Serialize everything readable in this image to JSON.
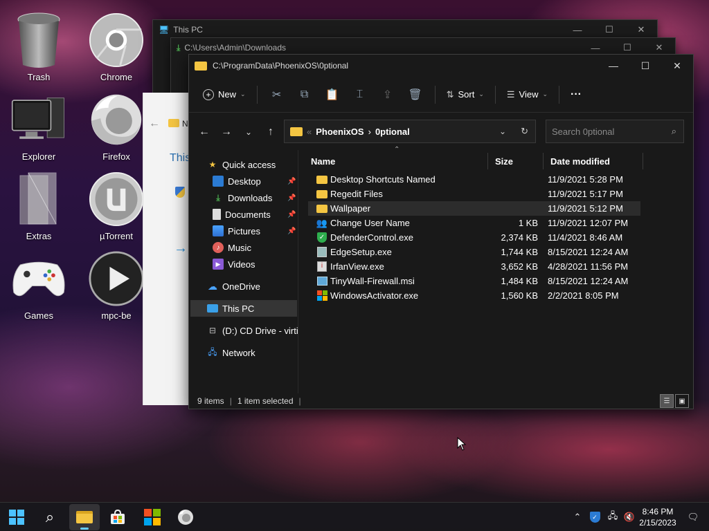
{
  "desktop": {
    "icons": [
      {
        "label": "Trash",
        "icon": "trash-icon"
      },
      {
        "label": "Chrome",
        "icon": "chrome-icon"
      },
      {
        "label": "Explorer",
        "icon": "explorer-icon"
      },
      {
        "label": "Firefox",
        "icon": "firefox-icon"
      },
      {
        "label": "Extras",
        "icon": "extras-icon"
      },
      {
        "label": "µTorrent",
        "icon": "utorrent-icon"
      },
      {
        "label": "Games",
        "icon": "games-icon"
      },
      {
        "label": "mpc-be",
        "icon": "mpc-be-icon"
      }
    ]
  },
  "back_windows": {
    "this_pc": {
      "title": "This PC"
    },
    "downloads": {
      "title": "C:\\Users\\Admin\\Downloads"
    },
    "partial": {
      "letter": "N",
      "text": "This"
    }
  },
  "main_window": {
    "title": "C:\\ProgramData\\PhoenixOS\\0ptional",
    "toolbar": {
      "new_label": "New",
      "sort_label": "Sort",
      "view_label": "View",
      "more_label": "···"
    },
    "address": {
      "prefix": "«",
      "crumbs": [
        "PhoenixOS",
        "0ptional"
      ],
      "separator": "›"
    },
    "search": {
      "placeholder": "Search 0ptional"
    },
    "nav": [
      {
        "label": "Quick access",
        "icon": "star-icon"
      },
      {
        "label": "Desktop",
        "icon": "desktop-icon",
        "pinned": true
      },
      {
        "label": "Downloads",
        "icon": "download-icon",
        "pinned": true
      },
      {
        "label": "Documents",
        "icon": "document-icon",
        "pinned": true
      },
      {
        "label": "Pictures",
        "icon": "pictures-icon",
        "pinned": true
      },
      {
        "label": "Music",
        "icon": "music-icon"
      },
      {
        "label": "Videos",
        "icon": "videos-icon"
      },
      {
        "label": "OneDrive",
        "icon": "cloud-icon"
      },
      {
        "label": "This PC",
        "icon": "computer-icon",
        "selected": true
      },
      {
        "label": "(D:) CD Drive - virtio",
        "icon": "cd-drive-icon"
      },
      {
        "label": "Network",
        "icon": "network-icon"
      }
    ],
    "columns": {
      "name": "Name",
      "size": "Size",
      "date": "Date modified"
    },
    "files": [
      {
        "name": "Desktop Shortcuts Named",
        "size": "",
        "date": "11/9/2021 5:28 PM",
        "icon": "folder-icon"
      },
      {
        "name": "Regedit Files",
        "size": "",
        "date": "11/9/2021 5:17 PM",
        "icon": "folder-icon"
      },
      {
        "name": "Wallpaper",
        "size": "",
        "date": "11/9/2021 5:12 PM",
        "icon": "folder-icon",
        "selected": true
      },
      {
        "name": "Change User Name",
        "size": "1 KB",
        "date": "11/9/2021 12:07 PM",
        "icon": "users-icon"
      },
      {
        "name": "DefenderControl.exe",
        "size": "2,374 KB",
        "date": "11/4/2021 8:46 AM",
        "icon": "shield-icon"
      },
      {
        "name": "EdgeSetup.exe",
        "size": "1,744 KB",
        "date": "8/15/2021 12:24 AM",
        "icon": "installer-icon"
      },
      {
        "name": "IrfanView.exe",
        "size": "3,652 KB",
        "date": "4/28/2021 11:56 PM",
        "icon": "irfanview-icon"
      },
      {
        "name": "TinyWall-Firewall.msi",
        "size": "1,484 KB",
        "date": "8/15/2021 12:24 AM",
        "icon": "msi-icon"
      },
      {
        "name": "WindowsActivator.exe",
        "size": "1,560 KB",
        "date": "2/2/2021 8:05 PM",
        "icon": "windows-logo-icon"
      }
    ],
    "status": {
      "count": "9 items",
      "selection": "1 item selected"
    }
  },
  "taskbar": {
    "clock_time": "8:46 PM",
    "clock_date": "2/15/2023"
  },
  "colors": {
    "accent": "#4cc2ff",
    "folder": "#f4c542",
    "selection": "#2c2c2c"
  }
}
